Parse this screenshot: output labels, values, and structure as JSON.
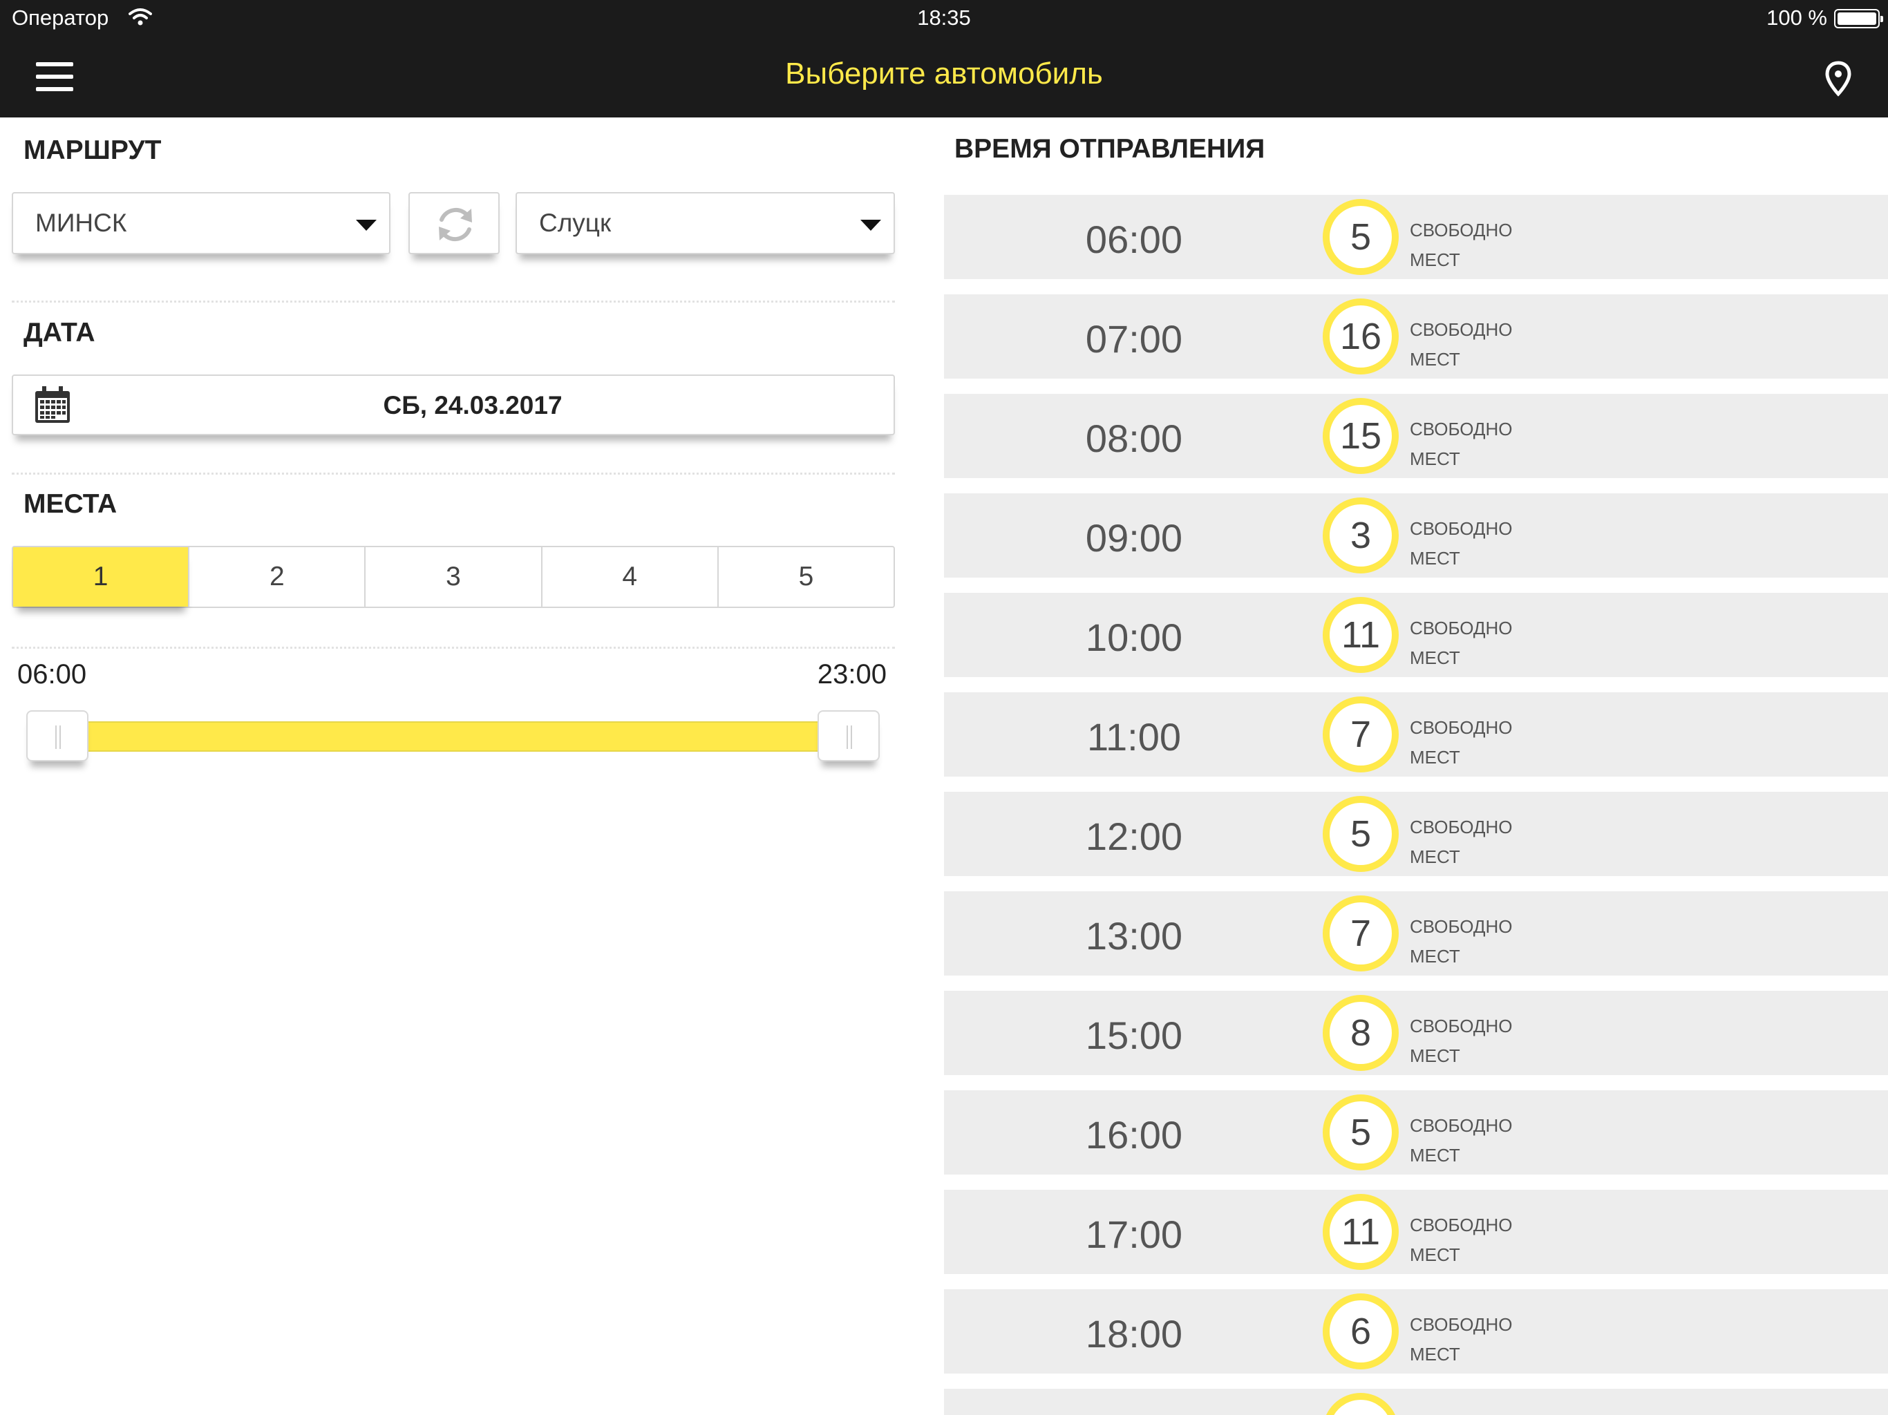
{
  "status_bar": {
    "carrier": "Оператор",
    "time": "18:35",
    "battery": "100 %"
  },
  "nav": {
    "title": "Выберите автомобиль"
  },
  "route": {
    "heading": "МАРШРУТ",
    "from": "МИНСК",
    "to": "Слуцк"
  },
  "date": {
    "heading": "ДАТА",
    "value": "СБ, 24.03.2017"
  },
  "seats": {
    "heading": "МЕСТА",
    "options": [
      "1",
      "2",
      "3",
      "4",
      "5"
    ],
    "selected": "1"
  },
  "time_range": {
    "from": "06:00",
    "to": "23:00"
  },
  "departures": {
    "heading": "ВРЕМЯ ОТПРАВЛЕНИЯ",
    "free_line1": "СВОБОДНО",
    "free_line2": "МЕСТ",
    "slots": [
      {
        "time": "06:00",
        "free": "5"
      },
      {
        "time": "07:00",
        "free": "16"
      },
      {
        "time": "08:00",
        "free": "15"
      },
      {
        "time": "09:00",
        "free": "3"
      },
      {
        "time": "10:00",
        "free": "11"
      },
      {
        "time": "11:00",
        "free": "7"
      },
      {
        "time": "12:00",
        "free": "5"
      },
      {
        "time": "13:00",
        "free": "7"
      },
      {
        "time": "15:00",
        "free": "8"
      },
      {
        "time": "16:00",
        "free": "5"
      },
      {
        "time": "17:00",
        "free": "11"
      },
      {
        "time": "18:00",
        "free": "6"
      },
      {
        "time": "",
        "free": ""
      }
    ]
  },
  "colors": {
    "accent": "#ffe94a",
    "bar": "#1b1b1b",
    "slot_bg": "#ededed"
  },
  "icons": {
    "menu": "hamburger-icon",
    "location": "map-pin-icon",
    "swap": "refresh-icon",
    "calendar": "calendar-icon",
    "wifi": "wifi-icon",
    "battery": "battery-icon"
  }
}
